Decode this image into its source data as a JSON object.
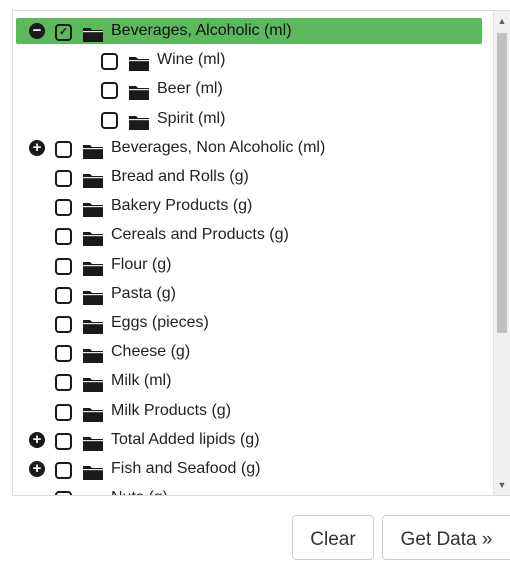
{
  "tree": {
    "items": [
      {
        "label": "Beverages, Alcoholic (ml)",
        "level": 0,
        "expander": "minus",
        "checked": true,
        "selected": true
      },
      {
        "label": "Wine (ml)",
        "level": 1,
        "expander": null,
        "checked": false,
        "selected": false
      },
      {
        "label": "Beer (ml)",
        "level": 1,
        "expander": null,
        "checked": false,
        "selected": false
      },
      {
        "label": "Spirit (ml)",
        "level": 1,
        "expander": null,
        "checked": false,
        "selected": false
      },
      {
        "label": "Beverages, Non Alcoholic (ml)",
        "level": 0,
        "expander": "plus",
        "checked": false,
        "selected": false
      },
      {
        "label": "Bread and Rolls (g)",
        "level": 0,
        "expander": null,
        "checked": false,
        "selected": false
      },
      {
        "label": "Bakery Products (g)",
        "level": 0,
        "expander": null,
        "checked": false,
        "selected": false
      },
      {
        "label": "Cereals and Products (g)",
        "level": 0,
        "expander": null,
        "checked": false,
        "selected": false
      },
      {
        "label": "Flour (g)",
        "level": 0,
        "expander": null,
        "checked": false,
        "selected": false
      },
      {
        "label": "Pasta (g)",
        "level": 0,
        "expander": null,
        "checked": false,
        "selected": false
      },
      {
        "label": "Eggs (pieces)",
        "level": 0,
        "expander": null,
        "checked": false,
        "selected": false
      },
      {
        "label": "Cheese (g)",
        "level": 0,
        "expander": null,
        "checked": false,
        "selected": false
      },
      {
        "label": "Milk (ml)",
        "level": 0,
        "expander": null,
        "checked": false,
        "selected": false
      },
      {
        "label": "Milk Products (g)",
        "level": 0,
        "expander": null,
        "checked": false,
        "selected": false
      },
      {
        "label": "Total Added lipids (g)",
        "level": 0,
        "expander": "plus",
        "checked": false,
        "selected": false
      },
      {
        "label": "Fish and Seafood (g)",
        "level": 0,
        "expander": "plus",
        "checked": false,
        "selected": false
      },
      {
        "label": "Nuts (g)",
        "level": 0,
        "expander": null,
        "checked": false,
        "selected": false
      }
    ]
  },
  "icons": {
    "expander_minus": "minus-circle-icon",
    "expander_plus": "plus-circle-icon",
    "checkbox": "checkbox-icon",
    "folder": "folder-icon",
    "scroll_up": "scroll-up-arrow-icon",
    "scroll_down": "scroll-down-arrow-icon"
  },
  "colors": {
    "selected_bg": "#5cb85c",
    "icon": "#1a1a1a"
  },
  "buttons": {
    "clear_label": "Clear",
    "get_data_label": "Get Data »"
  }
}
